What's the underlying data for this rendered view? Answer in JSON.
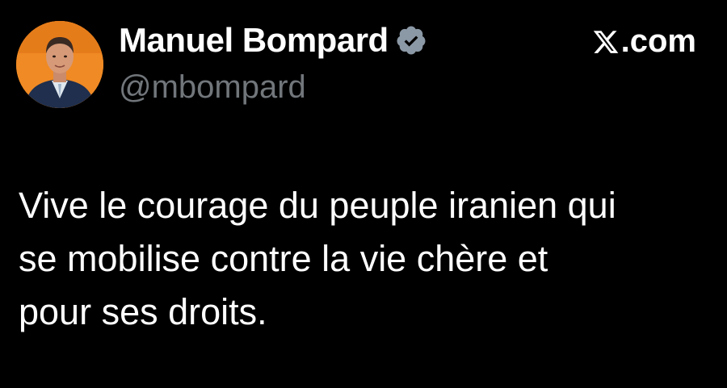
{
  "author": {
    "display_name": "Manuel Bompard",
    "handle": "@mbompard",
    "verified_icon": "verified-badge-icon",
    "avatar_icon": "profile-photo",
    "avatar_bg": "#f08a24"
  },
  "brand": {
    "label": ".com",
    "logo_icon": "x-logo-icon"
  },
  "tweet": {
    "lines": [
      "Vive le courage du peuple iranien qui",
      "se mobilise contre la vie chère et",
      "pour ses droits."
    ]
  },
  "colors": {
    "background": "#000000",
    "text": "#ffffff",
    "handle": "#71767b",
    "verified": "#8b98a5"
  }
}
